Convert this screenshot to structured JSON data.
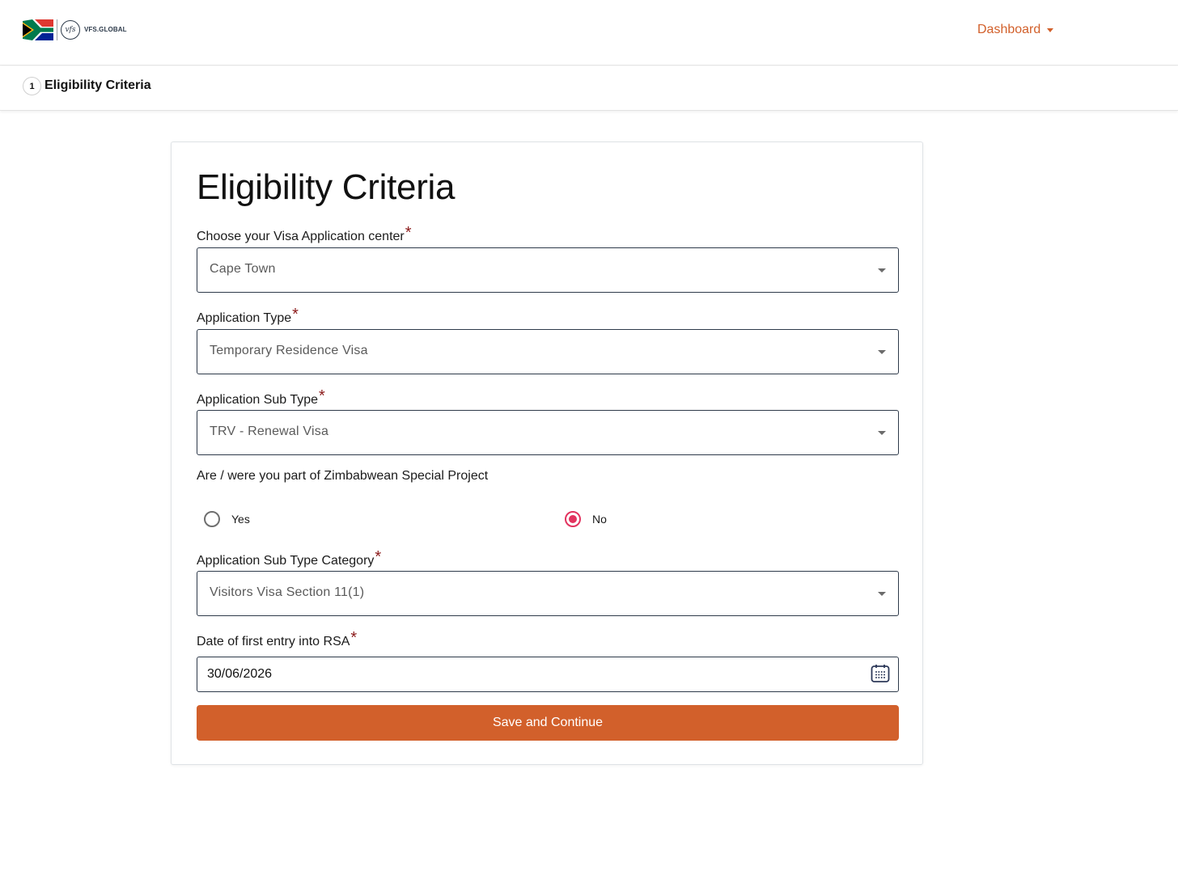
{
  "header": {
    "logo_text": "VFS.GLOBAL",
    "logo_badge": "vfs",
    "dashboard_label": "Dashboard"
  },
  "stepper": {
    "step_number": "1",
    "step_label": "Eligibility Criteria"
  },
  "form": {
    "title": "Eligibility Criteria",
    "required_mark": "*",
    "visa_center": {
      "label": "Choose your Visa Application center",
      "value": "Cape Town"
    },
    "application_type": {
      "label": "Application Type",
      "value": "Temporary Residence Visa"
    },
    "application_sub_type": {
      "label": "Application Sub Type",
      "value": "TRV - Renewal Visa"
    },
    "zimbabwean_question": {
      "label": "Are / were you part of Zimbabwean Special Project",
      "options": [
        {
          "label": "Yes",
          "checked": false
        },
        {
          "label": "No",
          "checked": true
        }
      ]
    },
    "sub_type_category": {
      "label": "Application Sub Type Category",
      "value": "Visitors Visa Section 11(1)"
    },
    "first_entry_date": {
      "label": "Date of first entry into RSA",
      "value": "30/06/2026"
    },
    "submit_label": "Save and Continue"
  },
  "colors": {
    "accent": "#d2602b",
    "radio_selected": "#e2335f",
    "required": "#8b1a1a"
  }
}
